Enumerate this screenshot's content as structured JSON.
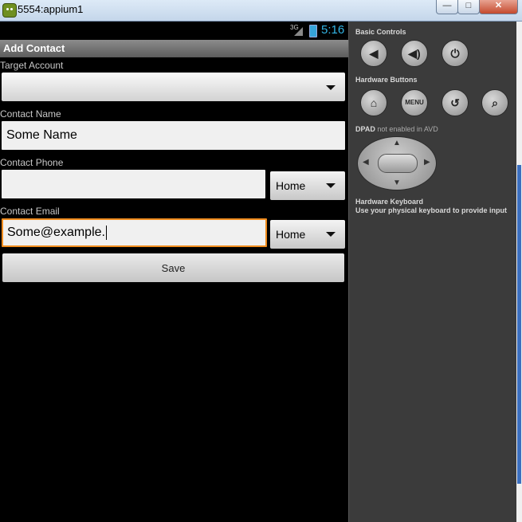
{
  "window": {
    "title": "5554:appium1",
    "minimize_glyph": "—",
    "maximize_glyph": "□",
    "close_glyph": "✕"
  },
  "status_bar": {
    "network": "3G",
    "time": "5:16"
  },
  "action_bar": {
    "title": "Add Contact"
  },
  "form": {
    "target_account_label": "Target Account",
    "target_account_value": "",
    "contact_name_label": "Contact Name",
    "contact_name_value": "Some Name",
    "contact_phone_label": "Contact Phone",
    "contact_phone_value": "",
    "contact_phone_type": "Home",
    "contact_email_label": "Contact Email",
    "contact_email_value": "Some@example.",
    "contact_email_type": "Home",
    "save_label": "Save"
  },
  "emulator_panel": {
    "basic_controls_label": "Basic Controls",
    "hardware_buttons_label": "Hardware Buttons",
    "menu_label": "MENU",
    "dpad_label": "DPAD",
    "dpad_note": "not enabled in AVD",
    "keyboard_title": "Hardware Keyboard",
    "keyboard_note": "Use your physical keyboard to provide input",
    "icons": [
      "volume-down-icon",
      "volume-up-icon",
      "power-icon",
      "home-icon",
      "back-icon",
      "search-icon"
    ]
  },
  "colors": {
    "accent_time": "#33b5e5",
    "focus_border": "#f08c1e",
    "panel_bg": "#3b3b3b"
  }
}
